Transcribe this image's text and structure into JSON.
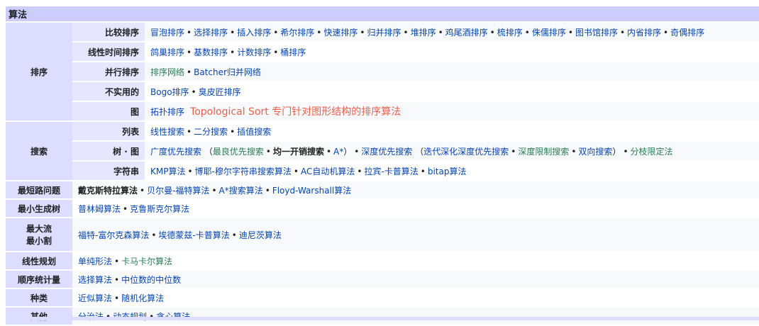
{
  "navbox": {
    "title": "算法",
    "groups": {
      "sorting": {
        "label": "排序",
        "compare": {
          "label": "比较排序",
          "items": [
            "冒泡排序",
            "选择排序",
            "插入排序",
            "希尔排序",
            "快速排序",
            "归并排序",
            "堆排序",
            "鸡尾酒排序",
            "梳排序",
            "侏儒排序",
            "图书馆排序",
            "内省排序",
            "奇偶排序"
          ]
        },
        "linear": {
          "label": "线性时间排序",
          "items": [
            "鸽巢排序",
            "基数排序",
            "计数排序",
            "桶排序"
          ]
        },
        "parallel": {
          "label": "并行排序",
          "items": [
            "排序网络",
            "Batcher归并网络"
          ]
        },
        "impractical": {
          "label": "不实用的",
          "items": [
            "Bogo排序",
            "臭皮匠排序"
          ]
        },
        "graph": {
          "label": "图",
          "items": [
            "拓扑排序"
          ],
          "note": "Topological Sort 专门针对图形结构的排序算法"
        }
      },
      "search": {
        "label": "搜索",
        "list": {
          "label": "列表",
          "items": [
            "线性搜索",
            "二分搜索",
            "插值搜索"
          ]
        },
        "tree": {
          "label": "树 · 图",
          "bfs": "广度优先搜索",
          "bfs_open": "（",
          "best_first": "最良优先搜索",
          "uniform_cost": "均一开销搜索",
          "astar": "A*",
          "bfs_close": "）",
          "dfs": "深度优先搜索",
          "dfs_open": "（",
          "iddfs": "迭代深化深度优先搜索",
          "dls": "深度限制搜索",
          "bidirectional": "双向搜索",
          "dfs_close": "）",
          "bnb": "分枝限定法"
        },
        "string": {
          "label": "字符串",
          "items": [
            "KMP算法",
            "博耶-穆尔字符串搜索算法",
            "AC自动机算法",
            "拉宾-卡普算法",
            "bitap算法"
          ]
        }
      },
      "shortest": {
        "label": "最短路问题",
        "items": [
          "戴克斯特拉算法",
          "贝尔曼-福特算法",
          "A*搜索算法",
          "Floyd-Warshall算法"
        ]
      },
      "mst": {
        "label": "最小生成树",
        "items": [
          "普林姆算法",
          "克鲁斯克尔算法"
        ]
      },
      "maxflow": {
        "label1": "最大流",
        "label2": "最小割",
        "items": [
          "福特-富尔克森算法",
          "埃德蒙兹-卡普算法",
          "迪尼茨算法"
        ]
      },
      "lp": {
        "label": "线性规划",
        "items": [
          "单纯形法",
          "卡马卡尔算法"
        ]
      },
      "order": {
        "label": "顺序统计量",
        "items": [
          "选择算法",
          "中位数的中位数"
        ]
      },
      "kinds": {
        "label": "种类",
        "items": [
          "近似算法",
          "随机化算法"
        ]
      },
      "other": {
        "label": "其他",
        "items": [
          "分治法",
          "动态规划",
          "贪心算法"
        ]
      }
    },
    "separator": "•"
  }
}
